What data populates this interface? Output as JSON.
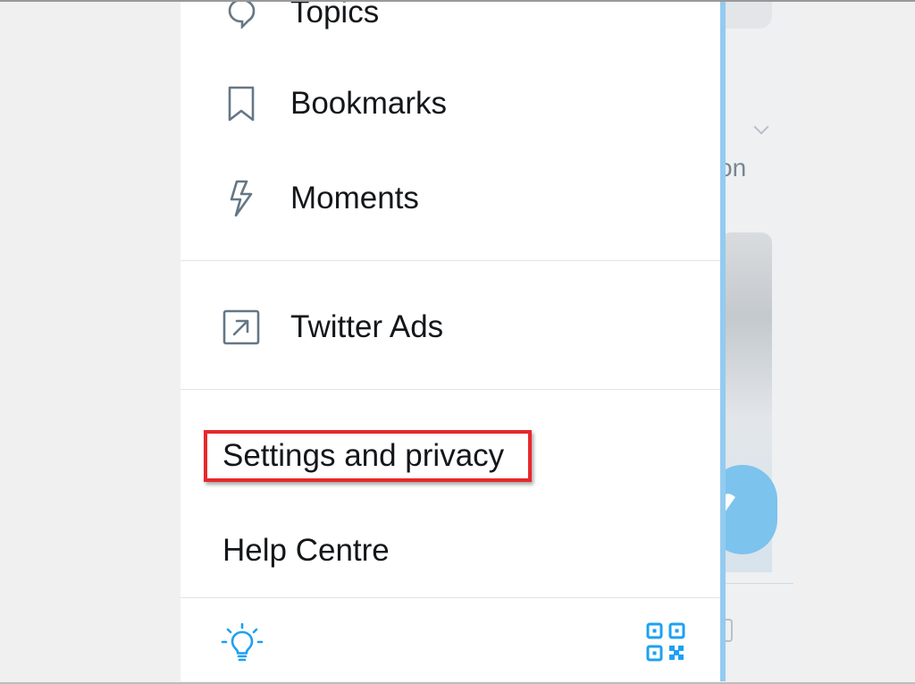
{
  "drawer": {
    "items": [
      {
        "label": "Topics",
        "icon": "topics-icon"
      },
      {
        "label": "Bookmarks",
        "icon": "bookmark-icon"
      },
      {
        "label": "Moments",
        "icon": "lightning-icon"
      },
      {
        "label": "Twitter Ads",
        "icon": "external-arrow-icon"
      },
      {
        "label": "Settings and privacy",
        "highlighted": true
      },
      {
        "label": "Help Centre"
      }
    ],
    "bottom_bar": {
      "left_icon": "lightbulb-icon",
      "right_icon": "qr-code-icon"
    }
  },
  "timeline": {
    "partial_text": "on"
  },
  "colors": {
    "accent": "#1da1f2",
    "highlight_border": "#e8282c",
    "drawer_edge": "#93cbf0",
    "text": "#14171a",
    "icon_gray": "#657786"
  }
}
